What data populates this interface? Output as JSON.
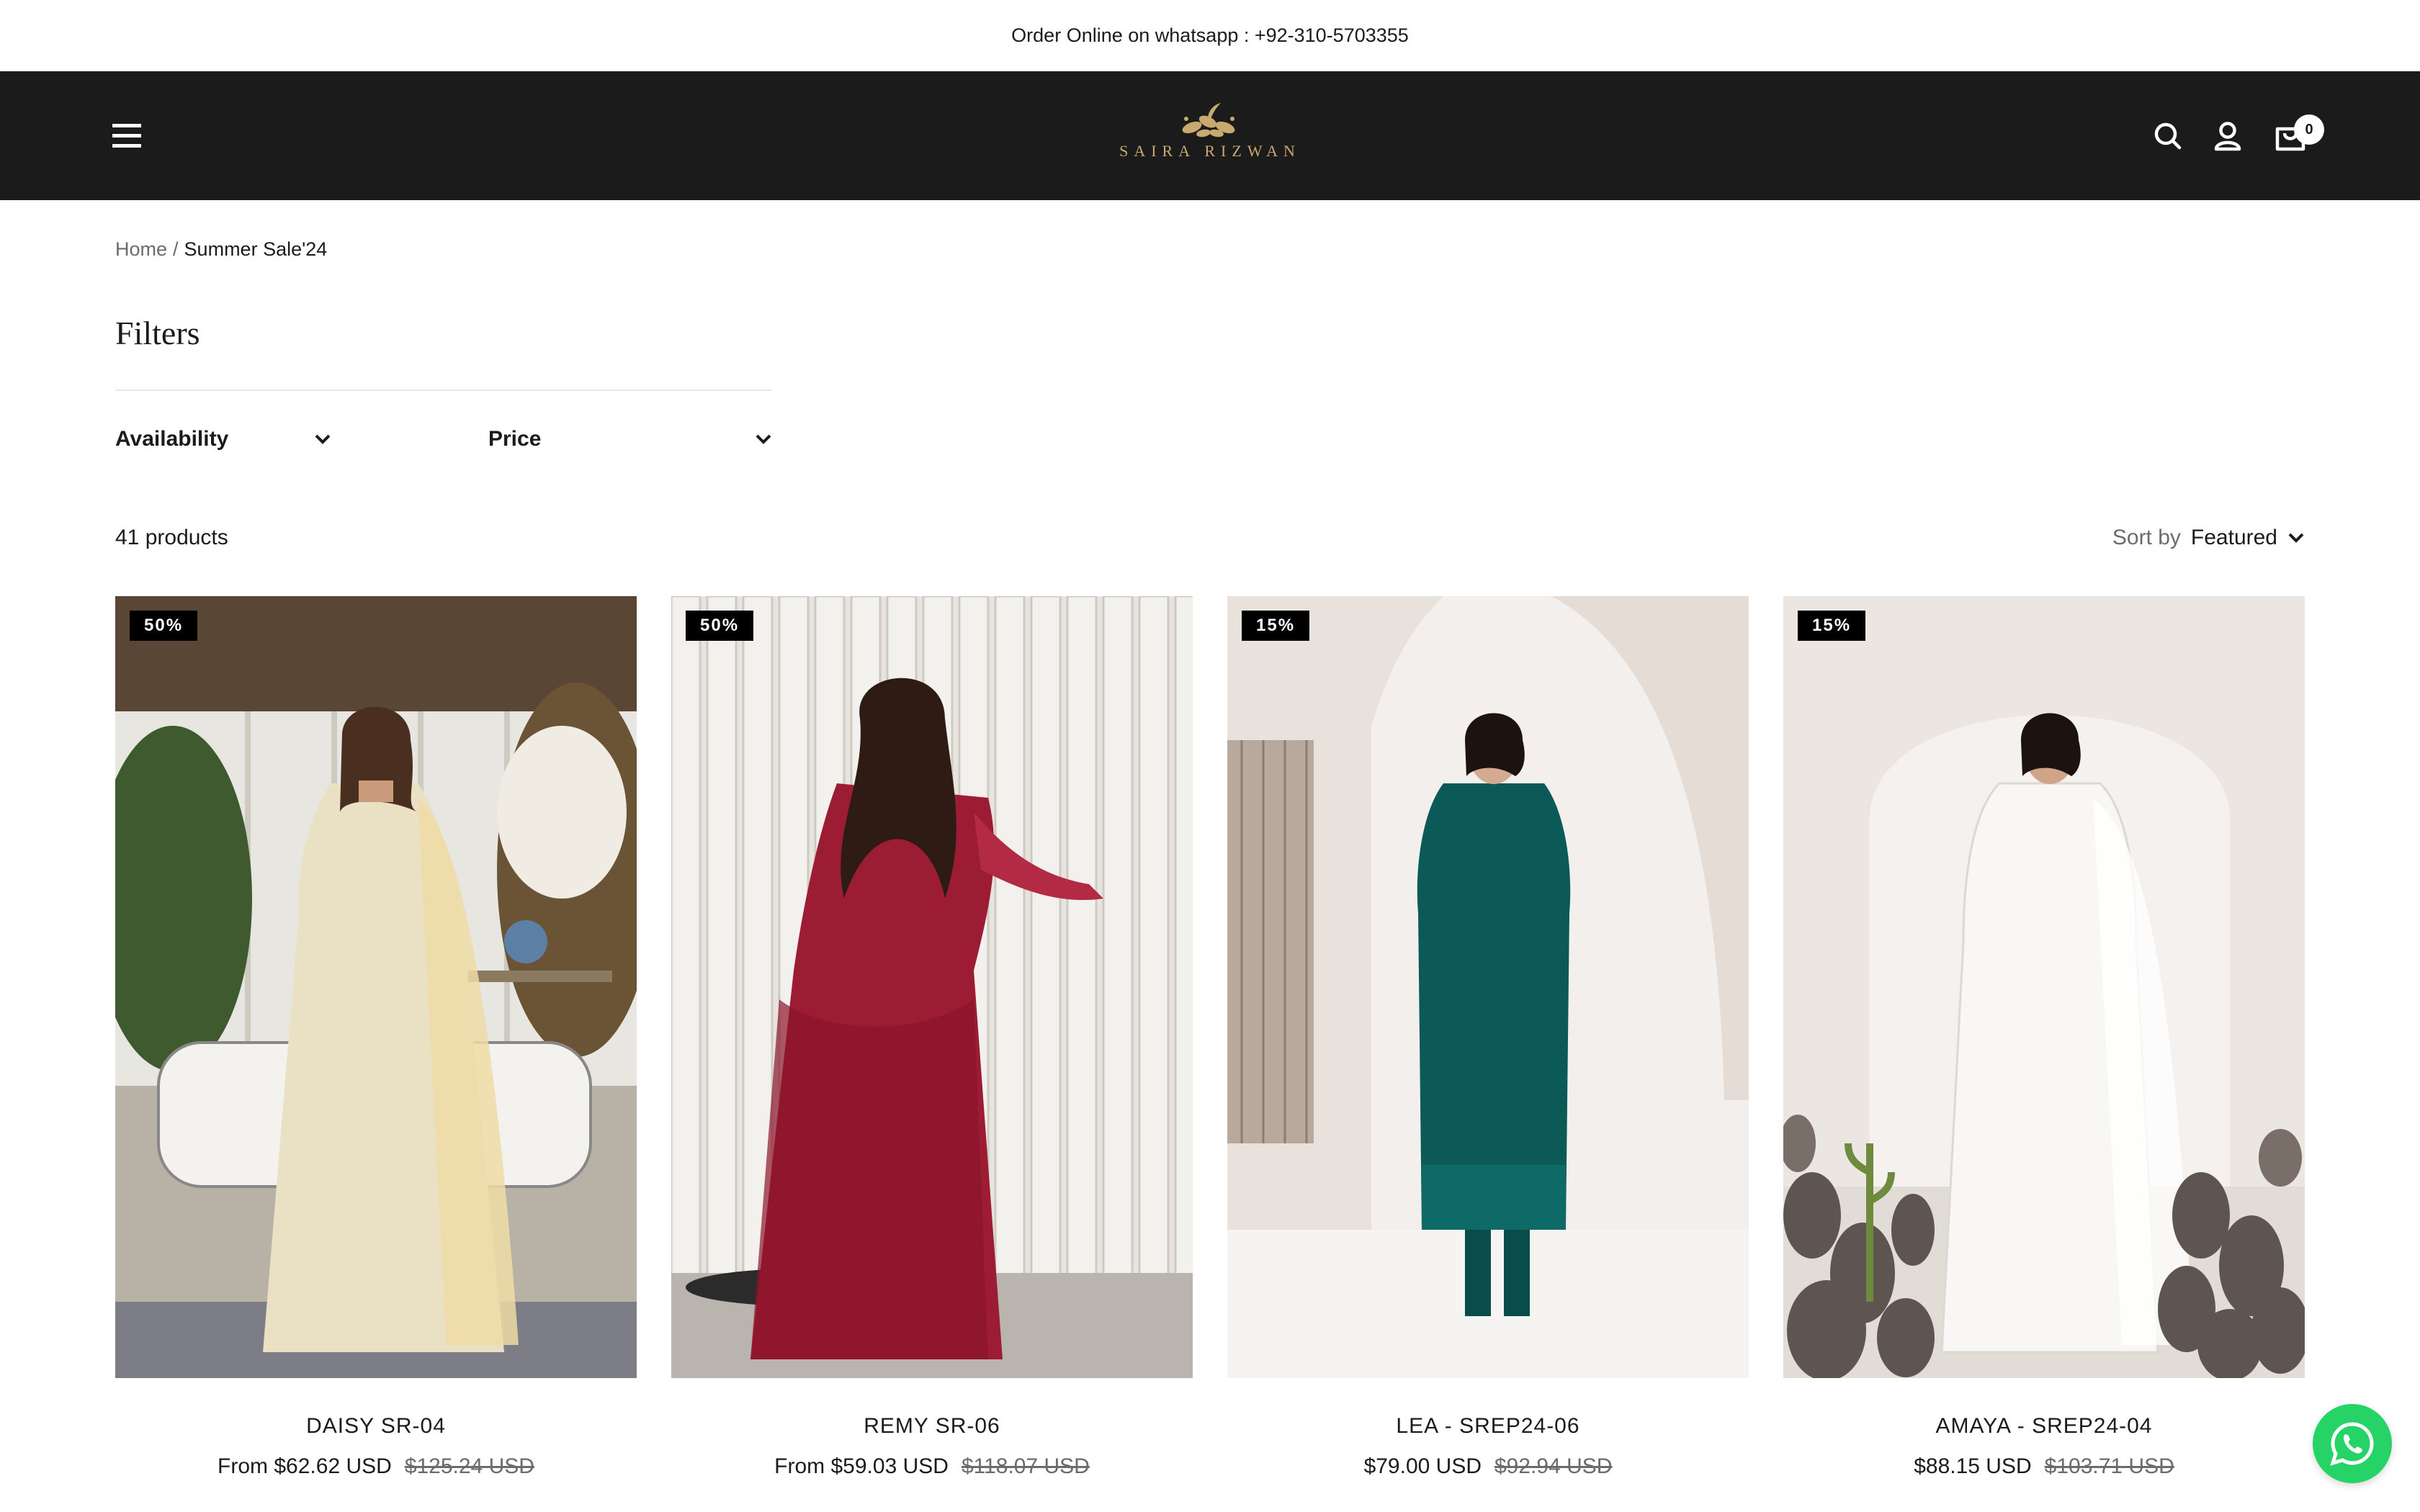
{
  "announcement": {
    "text": "Order Online on whatsapp : +92-310-5703355"
  },
  "header": {
    "brand": "SAIRA RIZWAN",
    "cart_count": "0",
    "icons": [
      "menu-icon",
      "search-icon",
      "account-icon",
      "cart-icon"
    ]
  },
  "breadcrumb": {
    "home": "Home",
    "separator": "/",
    "current": "Summer Sale'24"
  },
  "filters": {
    "title": "Filters",
    "items": [
      {
        "label": "Availability"
      },
      {
        "label": "Price"
      }
    ]
  },
  "listing": {
    "count": "41 products",
    "sort_label": "Sort by",
    "sort_value": "Featured"
  },
  "products": [
    {
      "badge": "50%",
      "title": "DAISY SR-04",
      "price": "From $62.62 USD",
      "compare_price": "$125.24 USD"
    },
    {
      "badge": "50%",
      "title": "REMY SR-06",
      "price": "From $59.03 USD",
      "compare_price": "$118.07 USD"
    },
    {
      "badge": "15%",
      "title": "LEA - SREP24-06",
      "price": "$79.00 USD",
      "compare_price": "$92.94 USD"
    },
    {
      "badge": "15%",
      "title": "AMAYA - SREP24-04",
      "price": "$88.15 USD",
      "compare_price": "$103.71 USD"
    }
  ],
  "colors": {
    "header_bg": "#1b1b1b",
    "logo_gold": "#c8a96e",
    "badge_bg": "#000000",
    "whatsapp": "#25d366"
  }
}
